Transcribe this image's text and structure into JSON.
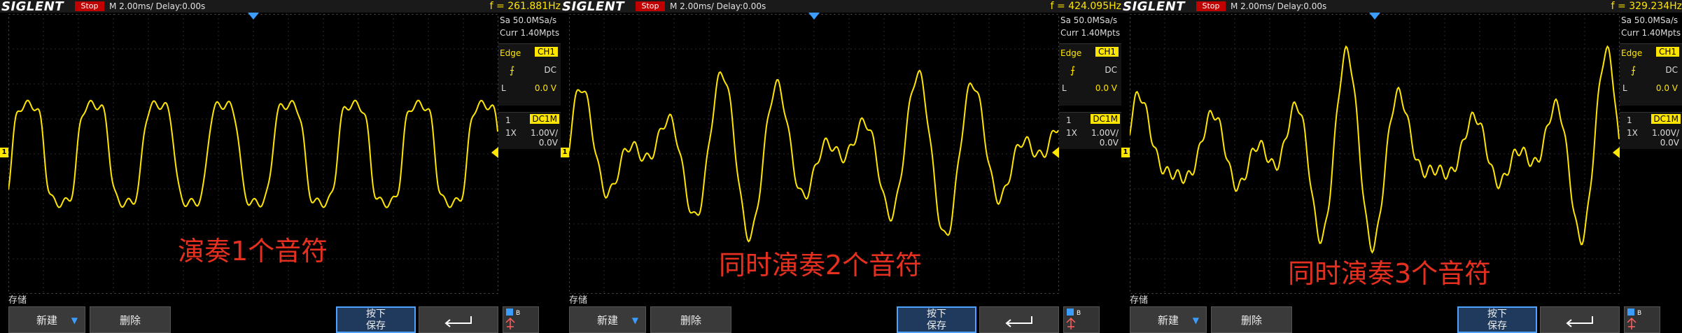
{
  "panels": [
    {
      "brand": "SIGLENT",
      "status": "Stop",
      "timebase": "M 2.00ms/ Delay:0.00s",
      "frequency": "f = 261.881Hz",
      "sample_rate": "Sa 50.0MSa/s",
      "curr": "Curr 1.40Mpts",
      "trigger_type": "Edge",
      "trigger_source": "CH1",
      "trigger_coupling": "DC",
      "trigger_level_label": "L",
      "trigger_level": "0.0 V",
      "channel_num": "1",
      "channel_coupling": "DC1M",
      "probe": "1X",
      "vdiv": "1.00V/",
      "offset": "0.0V",
      "ch1_marker": "1",
      "store_label": "存储",
      "buttons": {
        "new": "新建",
        "delete": "删除",
        "press_save_1": "按下",
        "press_save_2": "保存"
      },
      "annotation": "演奏1个音符",
      "trace_color": "#ffe600"
    },
    {
      "brand": "SIGLENT",
      "status": "Stop",
      "timebase": "M 2.00ms/ Delay:0.00s",
      "frequency": "f = 424.095Hz",
      "sample_rate": "Sa 50.0MSa/s",
      "curr": "Curr 1.40Mpts",
      "trigger_type": "Edge",
      "trigger_source": "CH1",
      "trigger_coupling": "DC",
      "trigger_level_label": "L",
      "trigger_level": "0.0 V",
      "channel_num": "1",
      "channel_coupling": "DC1M",
      "probe": "1X",
      "vdiv": "1.00V/",
      "offset": "0.0V",
      "ch1_marker": "1",
      "store_label": "存储",
      "buttons": {
        "new": "新建",
        "delete": "删除",
        "press_save_1": "按下",
        "press_save_2": "保存"
      },
      "annotation": "同时演奏2个音符",
      "trace_color": "#ffe600"
    },
    {
      "brand": "SIGLENT",
      "status": "Stop",
      "timebase": "M 2.00ms/ Delay:0.00s",
      "frequency": "f = 329.234Hz",
      "sample_rate": "Sa 50.0MSa/s",
      "curr": "Curr 1.40Mpts",
      "trigger_type": "Edge",
      "trigger_source": "CH1",
      "trigger_coupling": "DC",
      "trigger_level_label": "L",
      "trigger_level": "0.0 V",
      "channel_num": "1",
      "channel_coupling": "DC1M",
      "probe": "1X",
      "vdiv": "1.00V/",
      "offset": "0.0V",
      "ch1_marker": "1",
      "store_label": "存储",
      "buttons": {
        "new": "新建",
        "delete": "删除",
        "press_save_1": "按下",
        "press_save_2": "保存"
      },
      "annotation": "同时演奏3个音符",
      "trace_color": "#ffe600"
    }
  ]
}
